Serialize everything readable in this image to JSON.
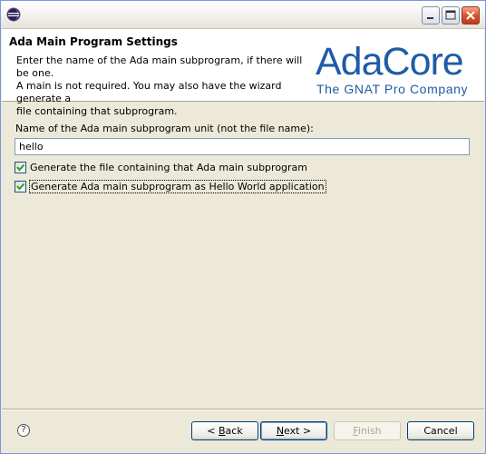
{
  "header": {
    "title": "Ada Main Program Settings",
    "description": "Enter the name of the Ada main subprogram, if there will be one.\nA main is not required. You may also have the wizard generate a\nfile containing that subprogram.",
    "logo_main": "AdaCore",
    "logo_tagline": "The GNAT Pro Company"
  },
  "form": {
    "name_label": "Name of the Ada main subprogram unit (not the file name):",
    "name_value": "hello",
    "check_generate_file": {
      "label": "Generate the file containing that Ada main subprogram",
      "checked": true
    },
    "check_hello_world": {
      "label": "Generate Ada main subprogram as Hello World application",
      "checked": true
    }
  },
  "buttons": {
    "back": {
      "pre": "< ",
      "mnemonic": "B",
      "rest": "ack"
    },
    "next": {
      "mnemonic": "N",
      "rest": "ext >"
    },
    "finish": {
      "mnemonic": "F",
      "rest": "inish"
    },
    "cancel": "Cancel"
  },
  "icons": {
    "app": "eclipse-icon",
    "help": "help-icon",
    "minimize": "minimize-icon",
    "maximize": "maximize-icon",
    "close": "close-icon"
  },
  "help_glyph": "?",
  "colors": {
    "brand": "#1f5ba6",
    "check": "#21a121"
  }
}
